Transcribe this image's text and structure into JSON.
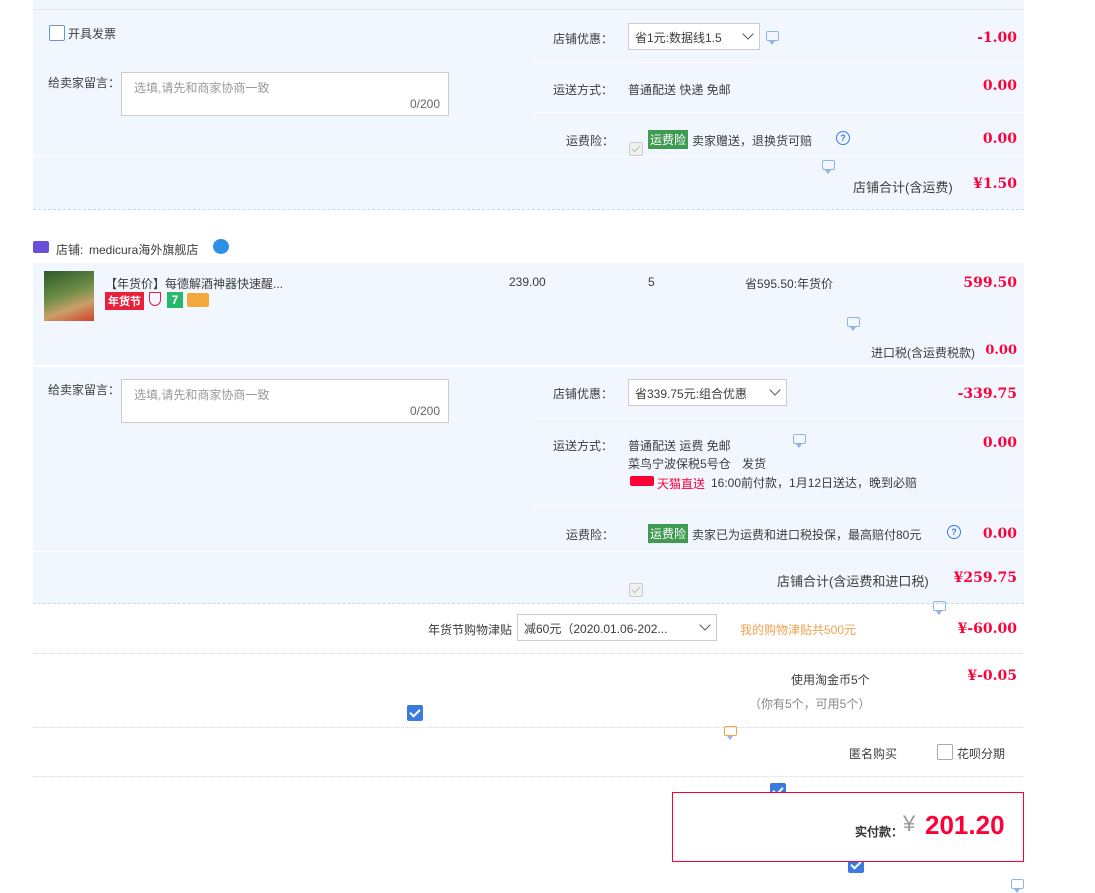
{
  "shop1": {
    "invoice_label": "开具发票",
    "note_label": "给卖家留言：",
    "note_placeholder": "选填,请先和商家协商一致",
    "note_count": "0/200",
    "discount_label": "店铺优惠：",
    "discount_value": "省1元:数据线1.5",
    "discount_amount": "-1.00",
    "shipping_label": "运送方式：",
    "shipping_value": "普通配送 快递 免邮",
    "shipping_amount": "0.00",
    "insurance_label": "运费险：",
    "insurance_tag": "运费险",
    "insurance_text": "卖家赠送，退换货可赔",
    "insurance_amount": "0.00",
    "total_label": "店铺合计(含运费)",
    "total_value": "¥1.50"
  },
  "shop2": {
    "shop_prefix": "店铺:",
    "shop_name": "medicura海外旗舰店",
    "item_title": "【年货价】每德解酒神器快速醒...",
    "item_badge": "年货节",
    "item_price": "239.00",
    "item_qty": "5",
    "item_saving": "省595.50:年货价",
    "item_subtotal": "599.50",
    "tax_label": "进口税(含运费税款)",
    "tax_value": "0.00",
    "note_label": "给卖家留言：",
    "note_placeholder": "选填,请先和商家协商一致",
    "note_count": "0/200",
    "discount_label": "店铺优惠：",
    "discount_value": "省339.75元:组合优惠",
    "discount_amount": "-339.75",
    "shipping_label": "运送方式：",
    "shipping_value": "普通配送 运费 免邮",
    "warehouse": "菜鸟宁波保税5号仓",
    "warehouse_action": "发货",
    "tmall_direct": "天猫直送",
    "delivery_note": "16:00前付款，1月12日送达，晚到必赔",
    "shipping_amount": "0.00",
    "insurance_label": "运费险：",
    "insurance_tag": "运费险",
    "insurance_text": "卖家已为运费和进口税投保，最高赔付80元",
    "insurance_amount": "0.00",
    "total_label": "店铺合计(含运费和进口税)",
    "total_value": "¥259.75"
  },
  "subsidy": {
    "label": "年货节购物津贴",
    "select_value": "减60元（2020.01.06-202...",
    "hint": "我的购物津贴共500元",
    "amount": "¥-60.00"
  },
  "coins": {
    "label": "使用淘金币5个",
    "sub": "（你有5个，可用5个）",
    "amount": "¥-0.05"
  },
  "options": {
    "anonymous_label": "匿名购买",
    "huabei_label": "花呗分期"
  },
  "pay": {
    "label": "实付款：",
    "currency": "¥",
    "amount": "201.20"
  },
  "colors": {
    "accent_red": "#ff0036",
    "panel_blue": "#f2f7ff",
    "check_blue": "#3a7be0",
    "insurance_green": "#3f9a52"
  }
}
